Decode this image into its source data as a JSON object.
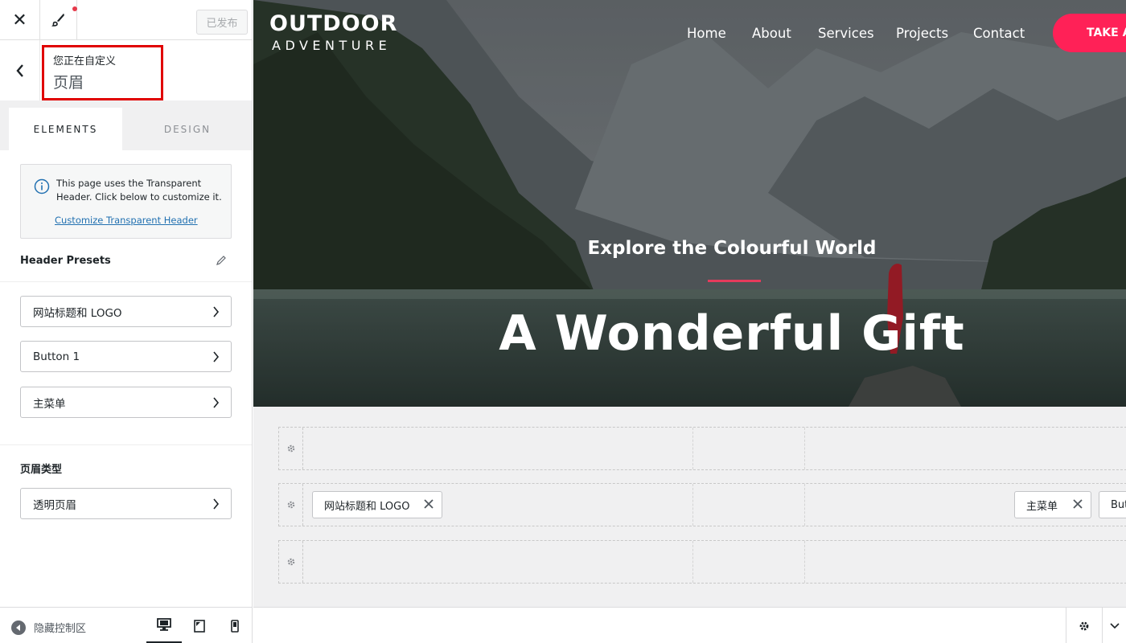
{
  "colors": {
    "accent": "#ff2157",
    "highlight_box": "#e00000",
    "link": "#2271b1"
  },
  "topbar": {
    "close_icon": "close-icon",
    "brush_icon": "brush-icon",
    "publish_label": "已发布"
  },
  "breadcrumb": {
    "small": "您正在自定义",
    "title": "页眉"
  },
  "tabs": [
    {
      "label": "ELEMENTS",
      "active": true
    },
    {
      "label": "DESIGN",
      "active": false
    }
  ],
  "notice": {
    "text": "This page uses the Transparent Header. Click below to customize it.",
    "link": "Customize Transparent Header"
  },
  "presets": {
    "title": "Header Presets"
  },
  "elements": [
    {
      "label": "网站标题和 LOGO"
    },
    {
      "label": "Button 1"
    },
    {
      "label": "主菜单"
    }
  ],
  "header_type": {
    "title": "页眉类型",
    "item": "透明页眉"
  },
  "footer": {
    "hide_label": "隐藏控制区",
    "devices": [
      "desktop-icon",
      "tablet-icon",
      "mobile-icon"
    ]
  },
  "site": {
    "logo_line1": "OUTDOOR",
    "logo_line2": "ADVENTURE",
    "nav": [
      "Home",
      "About",
      "Services",
      "Projects",
      "Contact"
    ],
    "cta": "TAKE A",
    "hero_sub": "Explore the Colourful World",
    "hero_title": "A Wonderful Gift"
  },
  "builder": {
    "chip_logo": "网站标题和 LOGO",
    "chip_menu": "主菜单",
    "chip_button": "Butt"
  }
}
